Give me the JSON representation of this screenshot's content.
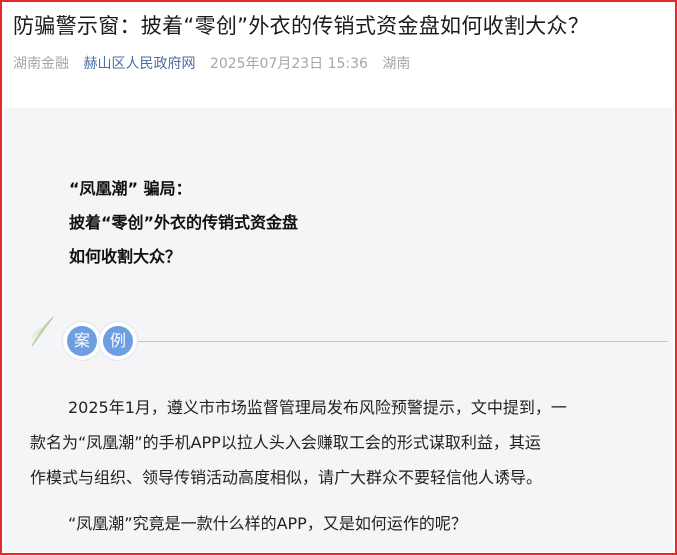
{
  "article": {
    "title": "防骗警示窗：披着“零创”外衣的传销式资金盘如何收割大众？",
    "meta": {
      "channel": "湖南金融",
      "source": "赫山区人民政府网",
      "datetime": "2025年07月23日 15:36",
      "region": "湖南"
    }
  },
  "content": {
    "heading_lines": [
      "“凤凰潮” 骗局：",
      "披着“零创”外衣的传销式资金盘",
      "如何收割大众？"
    ],
    "section_badge": [
      "案",
      "例"
    ],
    "paragraph_lines": [
      "2025年1月，遵义市市场监督管理局发布风险预警提示，文中提到，一",
      "款名为“凤凰潮”的手机APP以拉人头入会赚取工会的形式谋取利益，其运",
      "作模式与组织、领导传销活动高度相似，请广大群众不要轻信他人诱导。"
    ],
    "question": "“凤凰潮”究竟是一款什么样的APP，又是如何运作的呢？"
  },
  "colors": {
    "frame_border": "#e8282b",
    "badge_fill": "#6d9ee0",
    "source_link": "#4a6ea8",
    "card_background": "#f5f5f8"
  },
  "icons": {
    "section_decoration": "leaf-icon"
  }
}
